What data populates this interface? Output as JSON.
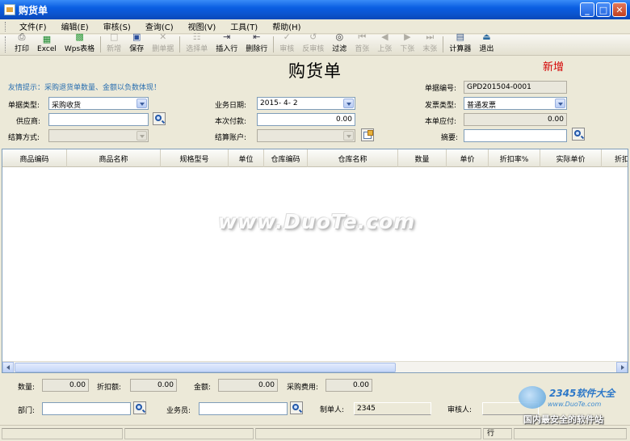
{
  "window": {
    "title": "购货单"
  },
  "menu": [
    "文件(F)",
    "编辑(E)",
    "审核(S)",
    "查询(C)",
    "视图(V)",
    "工具(T)",
    "帮助(H)"
  ],
  "toolbar": [
    {
      "label": "打印",
      "icon": "printer-icon",
      "enabled": true
    },
    {
      "label": "Excel",
      "icon": "excel-icon",
      "enabled": true
    },
    {
      "label": "Wps表格",
      "icon": "wps-icon",
      "enabled": true
    },
    {
      "sep": true
    },
    {
      "label": "新增",
      "icon": "new-doc-icon",
      "enabled": false
    },
    {
      "label": "保存",
      "icon": "save-icon",
      "enabled": true
    },
    {
      "label": "删单据",
      "icon": "delete-icon",
      "enabled": false
    },
    {
      "sep": true
    },
    {
      "label": "选择单",
      "icon": "select-icon",
      "enabled": false
    },
    {
      "label": "插入行",
      "icon": "insert-row-icon",
      "enabled": true
    },
    {
      "label": "删除行",
      "icon": "delete-row-icon",
      "enabled": true
    },
    {
      "sep": true
    },
    {
      "label": "审核",
      "icon": "audit-icon",
      "enabled": false
    },
    {
      "label": "反审核",
      "icon": "unaudit-icon",
      "enabled": false
    },
    {
      "label": "过滤",
      "icon": "binoculars-icon",
      "enabled": true
    },
    {
      "label": "首张",
      "icon": "first-icon",
      "enabled": false
    },
    {
      "label": "上张",
      "icon": "prev-icon",
      "enabled": false
    },
    {
      "label": "下张",
      "icon": "next-icon",
      "enabled": false
    },
    {
      "label": "末张",
      "icon": "last-icon",
      "enabled": false
    },
    {
      "sep": true
    },
    {
      "label": "计算器",
      "icon": "calculator-icon",
      "enabled": true
    },
    {
      "label": "退出",
      "icon": "exit-icon",
      "enabled": true
    }
  ],
  "form": {
    "doc_title": "购货单",
    "status_tag": "新增",
    "tip": "友情提示：采购退货单数量、金额以负数体现！",
    "doc_no_label": "单据编号:",
    "doc_no": "GPD201504-0001",
    "doc_type_label": "单据类型:",
    "doc_type": "采购收货",
    "biz_date_label": "业务日期:",
    "biz_date": "2015- 4- 2",
    "invoice_type_label": "发票类型:",
    "invoice_type": "普通发票",
    "supplier_label": "供应商:",
    "supplier": "",
    "payment_now_label": "本次付款:",
    "payment_now": "0.00",
    "payable_label": "本单应付:",
    "payable": "0.00",
    "settle_method_label": "结算方式:",
    "settle_method": "",
    "settle_account_label": "结算账户:",
    "settle_account": "",
    "summary_label": "摘要:",
    "summary": ""
  },
  "table": {
    "columns": [
      "商品编码",
      "商品名称",
      "规格型号",
      "单位",
      "仓库编码",
      "仓库名称",
      "数量",
      "单价",
      "折扣率%",
      "实际单价",
      "折扣额"
    ]
  },
  "watermark": "www.DuoTe.com",
  "footer": {
    "qty_label": "数量:",
    "qty": "0.00",
    "discount_label": "折扣额:",
    "discount": "0.00",
    "amount_label": "金额:",
    "amount": "0.00",
    "purchase_fee_label": "采购费用:",
    "purchase_fee": "0.00",
    "dept_label": "部门:",
    "dept": "",
    "staff_label": "业务员:",
    "staff": "",
    "maker_label": "制单人:",
    "maker": "2345",
    "auditor_label": "审核人:",
    "auditor": ""
  },
  "statusbar": {
    "row_label": "行"
  },
  "corner_logo": {
    "brand": "2345软件大全",
    "site": "www.DuoTe.com",
    "slogan": "国内最安全的软件站"
  }
}
